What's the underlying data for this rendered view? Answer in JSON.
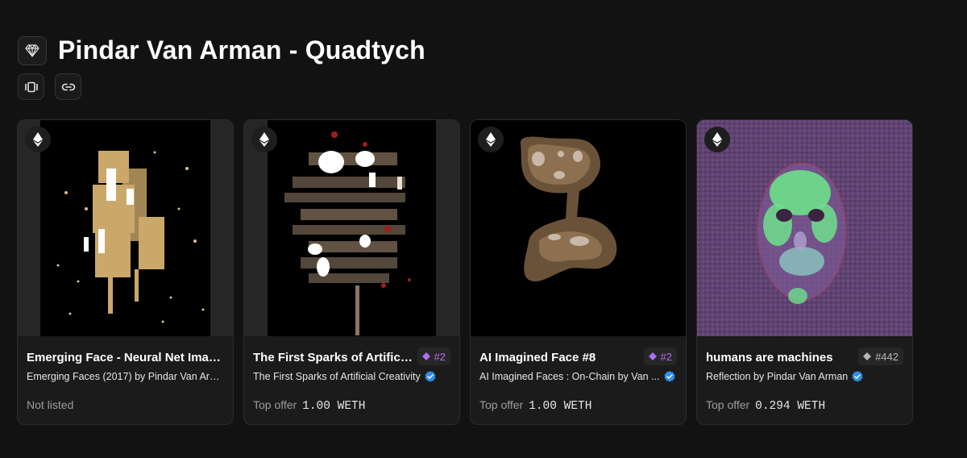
{
  "page": {
    "title": "Pindar Van Arman - Quadtych",
    "gem_icon": "gem-icon",
    "actions": [
      {
        "icon": "carousel-icon"
      },
      {
        "icon": "link-icon"
      }
    ]
  },
  "colors": {
    "background": "#121212",
    "card": "#1b1b1b",
    "rank_purple": "#b26df0",
    "verified_blue": "#2f8ee8"
  },
  "cards": [
    {
      "name": "Emerging Face - Neural Net Imagin...",
      "collection": "Emerging Faces (2017) by Pindar Van Arman",
      "status": "Not listed",
      "chain_icon": "ethereum-icon"
    },
    {
      "name": "The First Sparks of Artificia...",
      "rank": "#2",
      "collection": "The First Sparks of Artificial Creativity",
      "offer_label": "Top offer",
      "offer_value": "1.00 WETH",
      "chain_icon": "ethereum-icon"
    },
    {
      "name": "AI Imagined Face #8",
      "rank": "#2",
      "collection": "AI Imagined Faces : On-Chain by Van ...",
      "offer_label": "Top offer",
      "offer_value": "1.00 WETH",
      "chain_icon": "ethereum-icon"
    },
    {
      "name": "humans are machines",
      "rank": "#442",
      "collection": "Reflection by Pindar Van Arman",
      "offer_label": "Top offer",
      "offer_value": "0.294 WETH",
      "chain_icon": "ethereum-icon"
    }
  ]
}
